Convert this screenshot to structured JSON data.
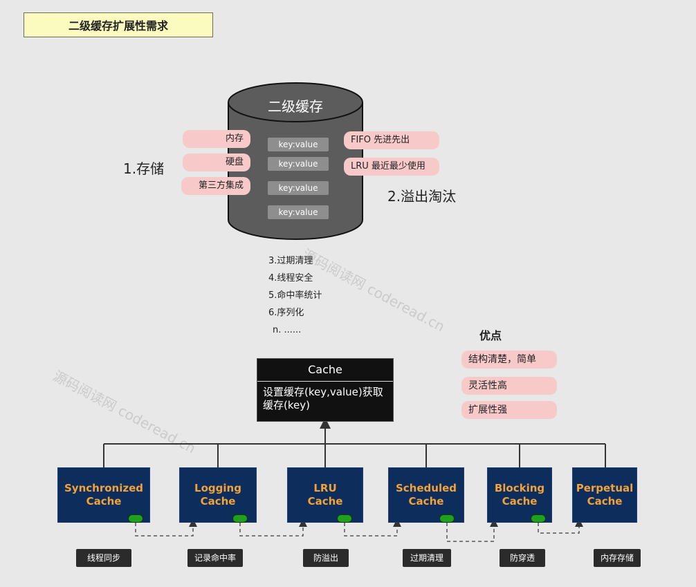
{
  "title": "二级缓存扩展性需求",
  "cylinder": {
    "title": "二级缓存",
    "entries": [
      "key:value",
      "key:value",
      "key:value",
      "key:value"
    ]
  },
  "storage": {
    "label": "1.存储",
    "items": [
      "内存",
      "硬盘",
      "第三方集成"
    ]
  },
  "eviction": {
    "label": "2.溢出淘汰",
    "items": [
      "FIFO 先进先出",
      "LRU 最近最少使用"
    ]
  },
  "features": [
    "3.过期清理",
    "4.线程安全",
    "5.命中率统计",
    "6.序列化",
    "n. ......"
  ],
  "advantages": {
    "title": "优点",
    "items": [
      "结构清楚，简单",
      "灵活性高",
      "扩展性强"
    ]
  },
  "cache_interface": {
    "name": "Cache",
    "description": "设置缓存(key,value)获取缓存(key)"
  },
  "implementations": [
    {
      "line1": "Synchronized",
      "line2": "Cache",
      "tag": "线程同步"
    },
    {
      "line1": "Logging",
      "line2": "Cache",
      "tag": "记录命中率"
    },
    {
      "line1": "LRU",
      "line2": "Cache",
      "tag": "防溢出"
    },
    {
      "line1": "Scheduled",
      "line2": "Cache",
      "tag": "过期清理"
    },
    {
      "line1": "Blocking",
      "line2": "Cache",
      "tag": "防穿透"
    },
    {
      "line1": "Perpetual",
      "line2": "Cache",
      "tag": "内存存储"
    }
  ],
  "watermark": "源码阅读网 coderead.cn",
  "colors": {
    "background": "#e8e8e8",
    "title_fill": "#fbfbc0",
    "cylinder": "#5c5c5c",
    "pill": "#f7c9c9",
    "impl_fill": "#0d2d5c",
    "impl_text": "#f2a23a",
    "connector_dot": "#1fa01f",
    "tag_fill": "#2b2b2b"
  }
}
